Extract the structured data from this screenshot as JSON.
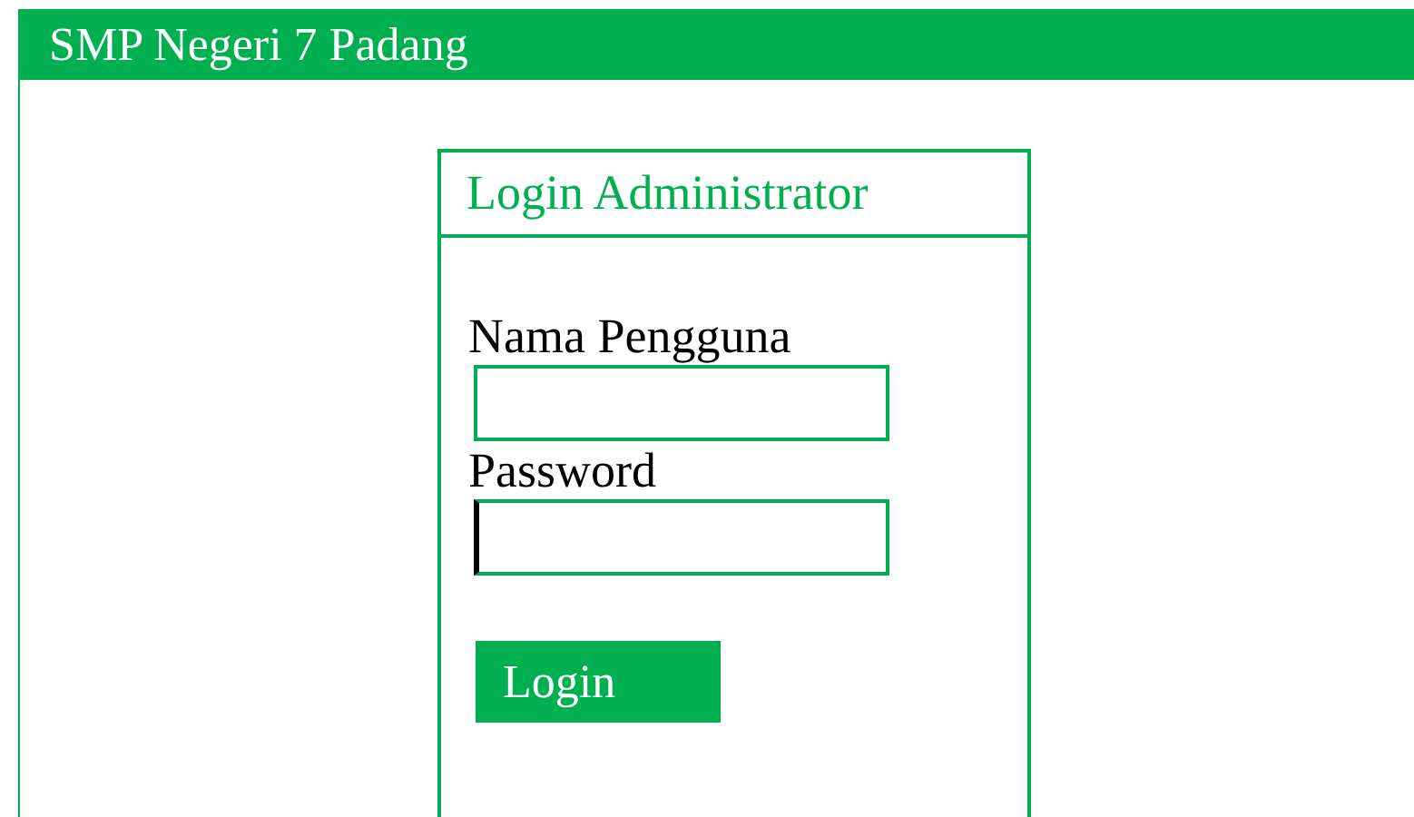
{
  "header": {
    "title": "SMP Negeri 7 Padang"
  },
  "login_panel": {
    "title": "Login Administrator",
    "fields": [
      {
        "label": "Nama Pengguna",
        "focused": false
      },
      {
        "label": "Password",
        "focused": true
      }
    ],
    "button": "Login"
  }
}
